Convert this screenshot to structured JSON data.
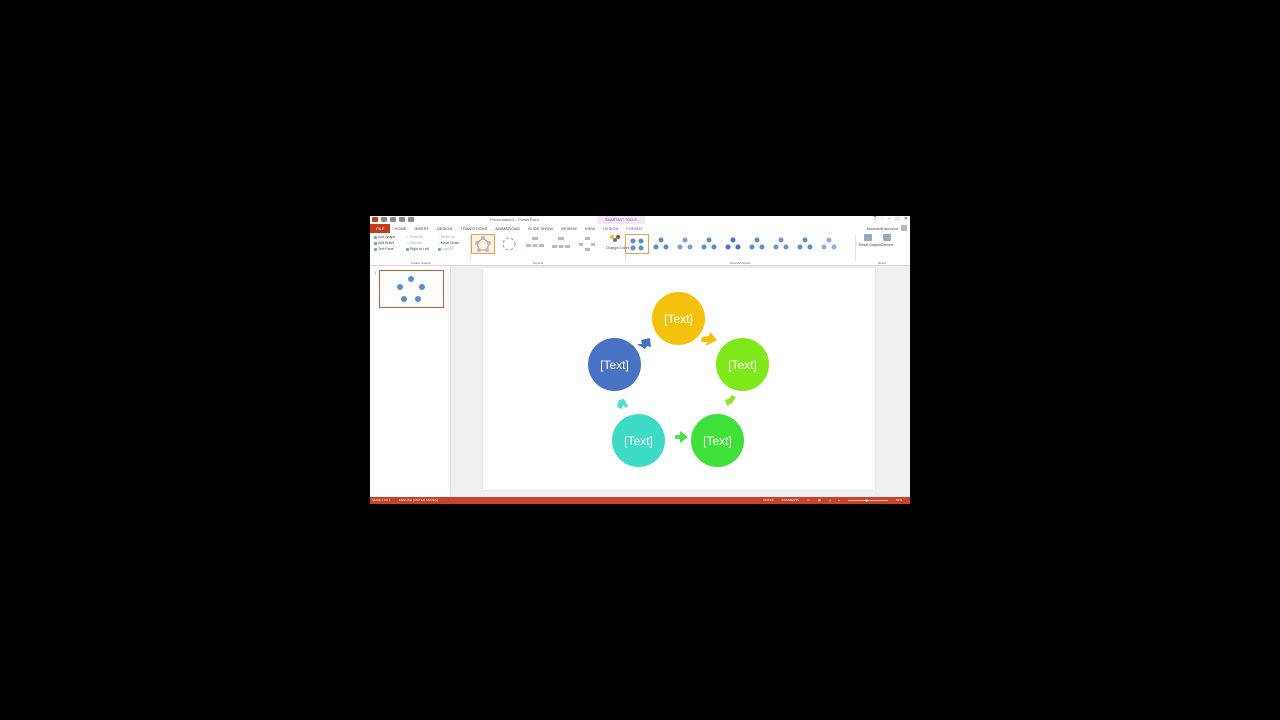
{
  "app": {
    "doc_title": "Presentation1 - PowerPoint",
    "context_title": "SMARTART TOOLS",
    "account": "Microsoft account"
  },
  "tabs": [
    {
      "label": "FILE"
    },
    {
      "label": "HOME"
    },
    {
      "label": "INSERT"
    },
    {
      "label": "DESIGN"
    },
    {
      "label": "TRANSITIONS"
    },
    {
      "label": "ANIMATIONS"
    },
    {
      "label": "SLIDE SHOW"
    },
    {
      "label": "REVIEW"
    },
    {
      "label": "VIEW"
    },
    {
      "label": "DESIGN"
    },
    {
      "label": "FORMAT"
    }
  ],
  "ribbon": {
    "create_graphic": {
      "label": "Create Graphic",
      "commands": [
        "Add Shape",
        "Add Bullet",
        "Text Pane",
        "Promote",
        "Demote",
        "Right to Left",
        "Move Up",
        "Move Down",
        "Layout"
      ]
    },
    "layouts": {
      "label": "Layouts"
    },
    "change_colors": "Change Colors",
    "styles": {
      "label": "SmartArt Styles"
    },
    "reset": {
      "label": "Reset",
      "reset_graphic": "Reset Graphic",
      "convert": "Convert"
    }
  },
  "slides_pane": {
    "slide_number": "1"
  },
  "slide": {
    "nodes": [
      {
        "text": "[Text]",
        "color": "#f4c20d"
      },
      {
        "text": "[Text]",
        "color": "#7ee81a"
      },
      {
        "text": "[Text]",
        "color": "#3fe03a"
      },
      {
        "text": "[Text]",
        "color": "#3ddbc6"
      },
      {
        "text": "[Text]",
        "color": "#4a72c4"
      }
    ]
  },
  "status": {
    "slide_info": "SLIDE 1 OF 1",
    "language": "ENGLISH (UNITED STATES)",
    "notes": "NOTES",
    "comments": "COMMENTS",
    "zoom": "54%"
  }
}
